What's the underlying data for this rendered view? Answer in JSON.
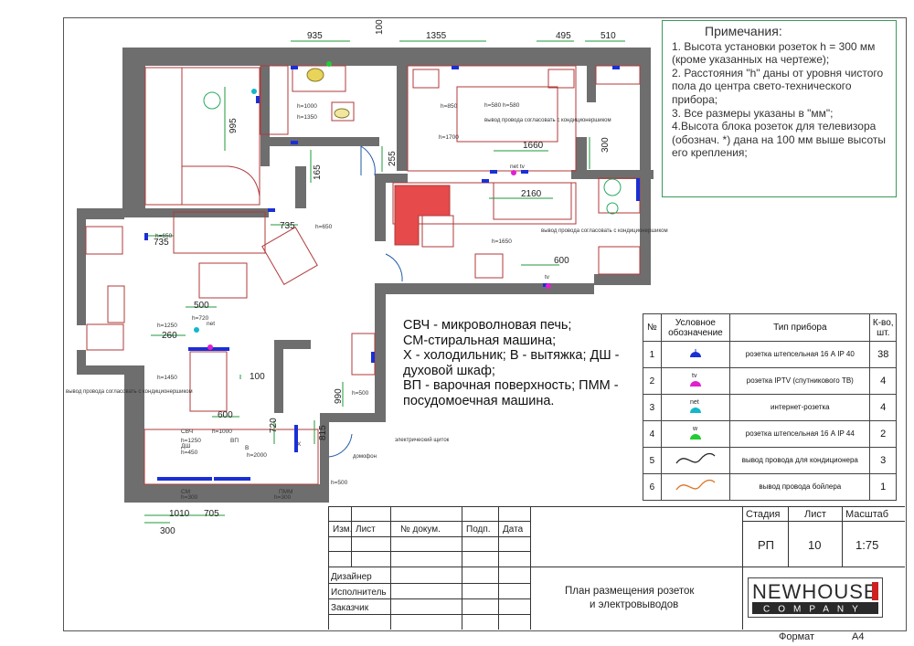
{
  "dimensions": {
    "d935": "935",
    "d100top": "100",
    "d1355": "1355",
    "d495": "495",
    "d510": "510",
    "d995": "995",
    "d165": "165",
    "d255": "255",
    "d1660": "1660",
    "d300r": "300",
    "d2160": "2160",
    "d735a": "735",
    "d735b": "735",
    "d600r": "600",
    "d500": "500",
    "d260": "260",
    "d100c": "100",
    "d600c": "600",
    "d990": "990",
    "d720": "720",
    "d815": "815",
    "d1010": "1010",
    "d705": "705",
    "d300b": "300"
  },
  "heights": {
    "h1000": "h=1000",
    "h1350": "h=1350",
    "h850": "h=850",
    "h580": "h=580 h=580",
    "h1700": "h=1700",
    "h650a": "h=650",
    "h650b": "h=650",
    "h1650": "h=1650",
    "h720": "h=720",
    "h1250": "h=1250",
    "h1450": "h=1450",
    "h500": "h=500",
    "h1000k": "h=1000",
    "h1250k": "h=1250",
    "h450": "h=450",
    "h2000": "h=2000",
    "h300k": "h=300",
    "h300pmm": "h=300",
    "h500r": "h=500"
  },
  "appliance_labels": {
    "svch": "СВЧ",
    "dsh": "ДШ",
    "vp": "ВП",
    "sm": "СМ",
    "pmm": "ПММ",
    "x": "Х",
    "v": "В",
    "net": "net",
    "tv": "tv",
    "net_tv": "net tv"
  },
  "annotations": {
    "ac_note_1": "вывод провода согласовать с кондиционершиком",
    "ac_note_2": "вывод провода согласовать с кондиционершиком",
    "ac_note_3": "вывод провода согласовать с кондиционершиком",
    "shield": "электрический щиток",
    "intercom": "домофон"
  },
  "notes": {
    "title": "Примечания:",
    "lines": [
      "1. Высота установки розеток h = 300 мм (кроме указанных на чертеже);",
      "2. Расстояния \"h\" даны от уровня чистого пола до центра свето-технического прибора;",
      "3. Все размеры указаны в \"мм\";",
      "4.Высота блока розеток для телевизора (обознач. *) дана на 100 мм выше высоты его крепления;"
    ]
  },
  "abbreviations": [
    "СВЧ - микроволновая печь;",
    "СМ-стиральная машина;",
    "Х - холодильник; В - вытяжка; ДШ -",
    "духовой шкаф;",
    "ВП - варочная поверхность; ПММ -",
    "посудомоечная машина."
  ],
  "spec_table": {
    "headers": {
      "num": "№",
      "symbol": "Условное обозначение",
      "type": "Тип прибора",
      "count": "К-во, шт."
    },
    "rows": [
      {
        "num": "1",
        "type": "розетка штепсельная 16 А IP 40",
        "count": "38",
        "symbol": "socket-blue",
        "color": "#1a2fd6"
      },
      {
        "num": "2",
        "type": "розетка IPTV (спутникового ТВ)",
        "count": "4",
        "symbol": "socket-tv",
        "color": "#e020d0",
        "tag": "tv"
      },
      {
        "num": "3",
        "type": "интернет-розетка",
        "count": "4",
        "symbol": "socket-net",
        "color": "#12b8c8",
        "tag": "net"
      },
      {
        "num": "4",
        "type": "розетка штепсельная 16 А IP 44",
        "count": "2",
        "symbol": "socket-wet",
        "color": "#22cc33",
        "tag": "w"
      },
      {
        "num": "5",
        "type": "вывод провода для кондиционера",
        "count": "3",
        "symbol": "wire-ac",
        "color": "#222222"
      },
      {
        "num": "6",
        "type": "вывод провода бойлера",
        "count": "1",
        "symbol": "wire-boiler",
        "color": "#e07020"
      }
    ]
  },
  "title_block": {
    "rev_headers": [
      "Изм.",
      "Лист",
      "№ докум.",
      "Подп.",
      "Дата"
    ],
    "roles": [
      "Дизайнер",
      "Исполнитель",
      "Заказчик"
    ],
    "drawing_title_1": "План размещения розеток",
    "drawing_title_2": "и электровыводов",
    "stage_label": "Стадия",
    "sheet_label": "Лист",
    "scale_label": "Масштаб",
    "stage": "РП",
    "sheet": "10",
    "scale": "1:75",
    "format_label": "Формат",
    "format": "А4",
    "logo_top": "NEWHOUSE",
    "logo_bottom": "COMPANY"
  },
  "colors": {
    "wall": "#6e6e6e",
    "furniture": "#b03a3a",
    "dim_green": "#1f9a3a",
    "socket_blue": "#1a2fd6",
    "accent_red": "#e64a4a",
    "logo_dark": "#2a2a2a",
    "logo_red": "#cc2222"
  }
}
